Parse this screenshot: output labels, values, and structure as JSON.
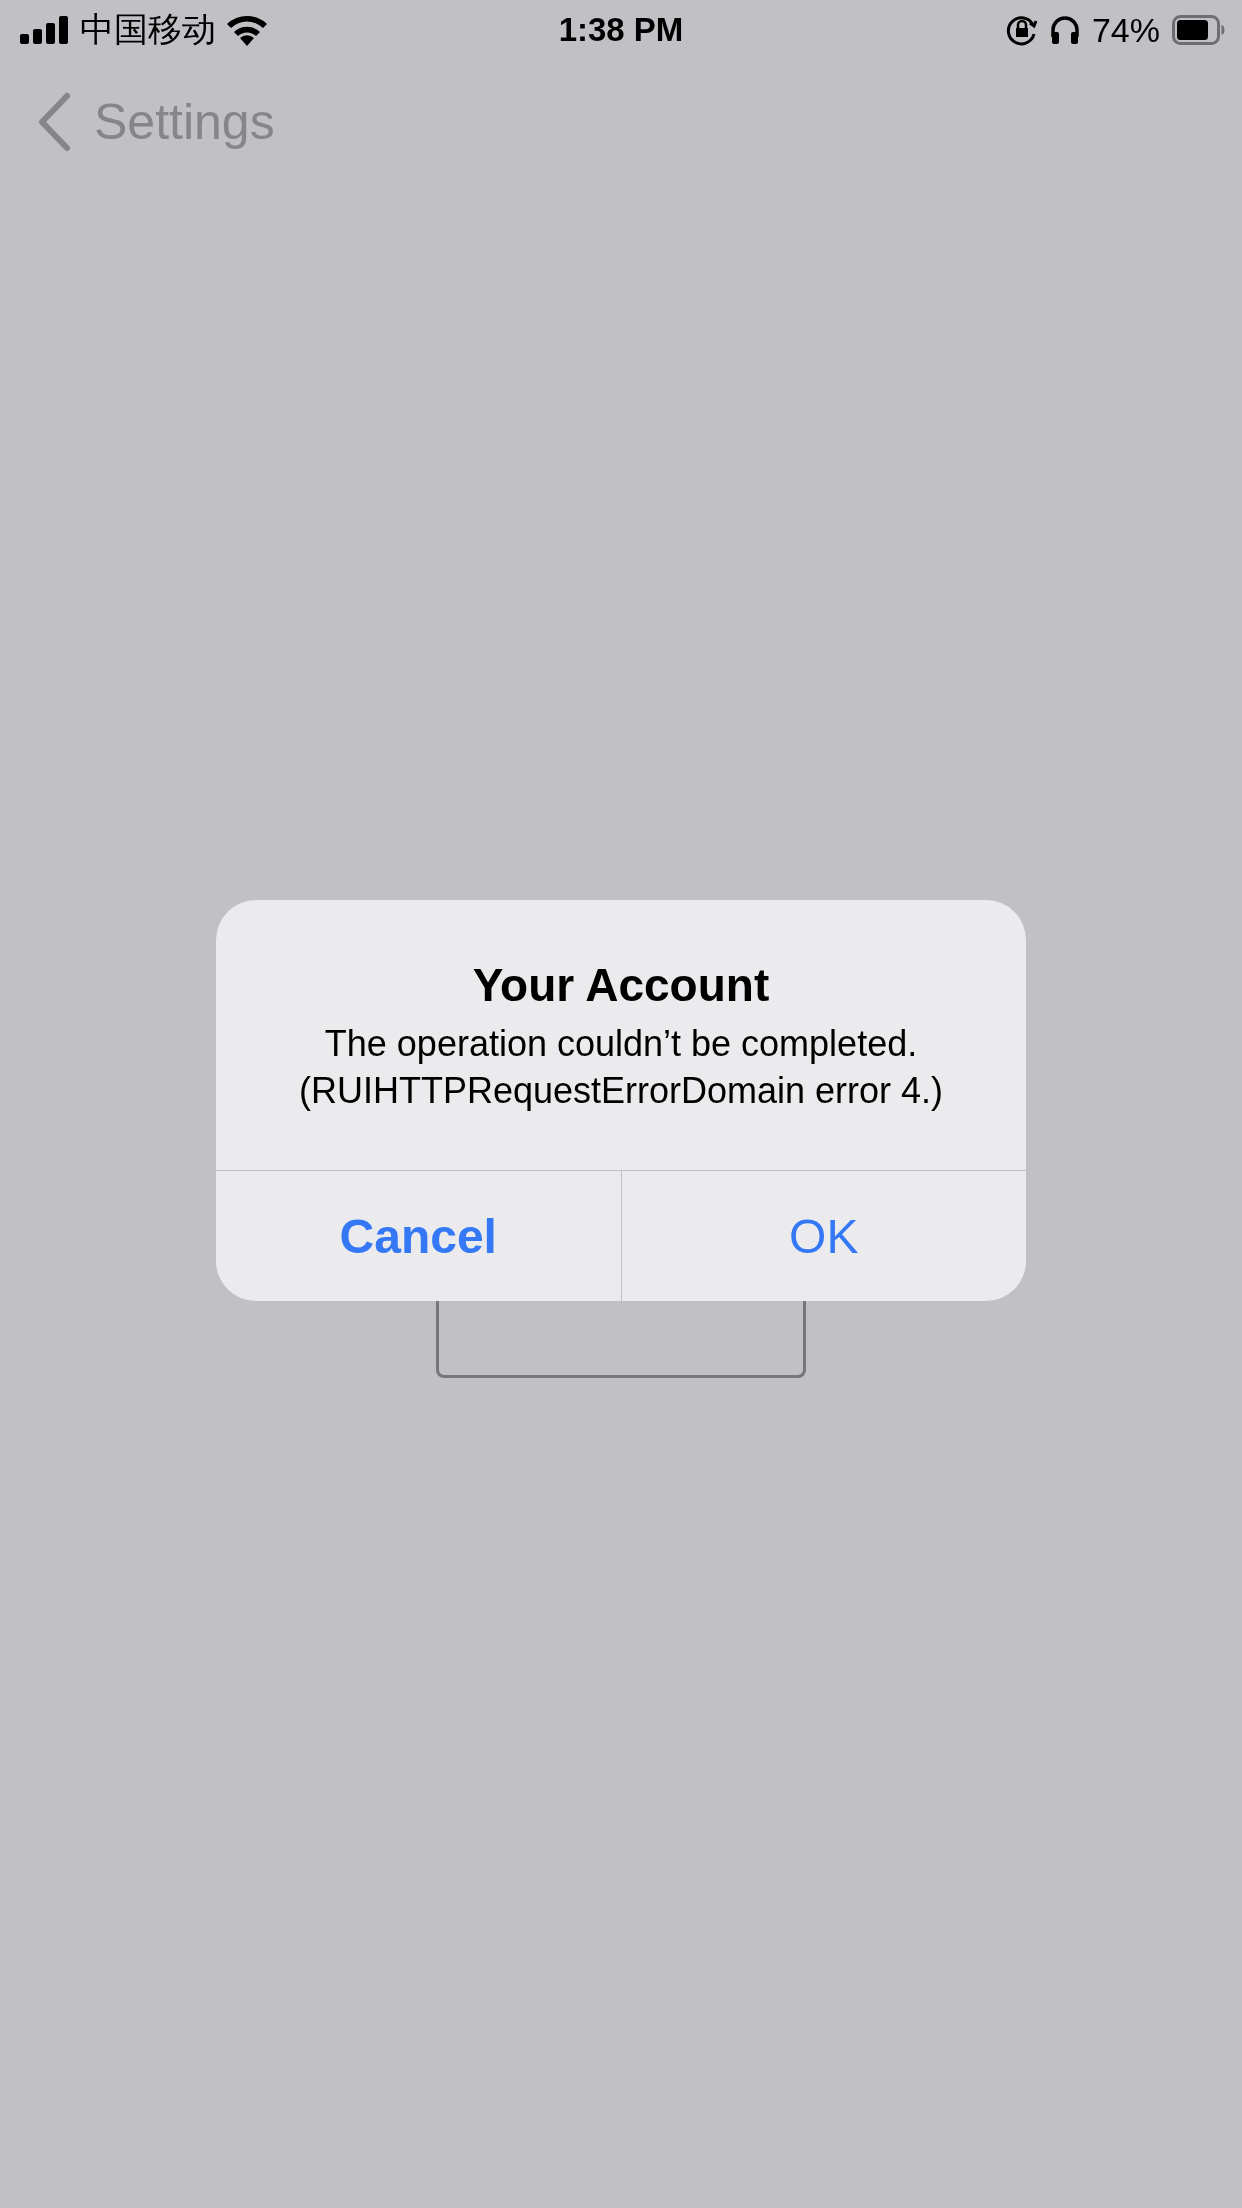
{
  "status_bar": {
    "carrier": "中国移动",
    "time": "1:38 PM",
    "battery": "74%"
  },
  "nav": {
    "back": "Settings"
  },
  "alert": {
    "title": "Your Account",
    "message": "The operation couldn’t be completed. (RUIHTTPRequestErrorDomain error 4.)",
    "buttons": [
      {
        "label": "Cancel",
        "preferred": true
      },
      {
        "label": "OK",
        "preferred": false
      }
    ]
  }
}
